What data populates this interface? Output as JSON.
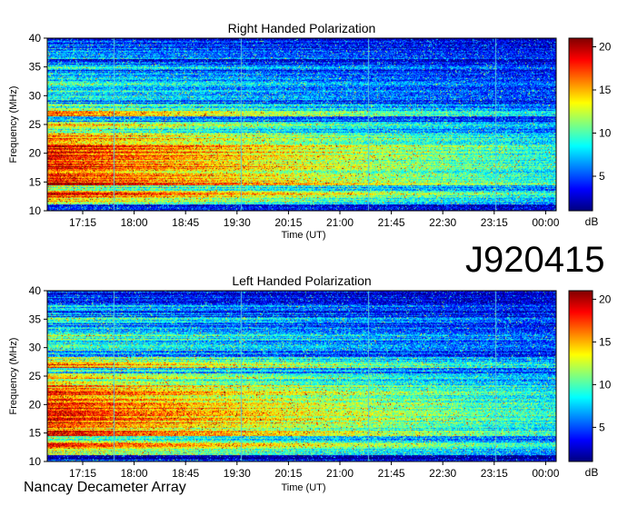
{
  "chart_data": [
    {
      "type": "heatmap",
      "title": "Right Handed Polarization",
      "xlabel": "Time (UT)",
      "ylabel": "Frequency (MHz)",
      "x_ticks": [
        "17:15",
        "18:00",
        "18:45",
        "19:30",
        "20:15",
        "21:00",
        "21:45",
        "22:30",
        "23:15",
        "00:00"
      ],
      "y_ticks": [
        "10",
        "15",
        "20",
        "25",
        "30",
        "35",
        "40"
      ],
      "ylim": [
        10,
        40
      ],
      "colorbar": {
        "ticks": [
          "5",
          "10",
          "15",
          "20"
        ],
        "label": "dB",
        "range": [
          1,
          21
        ]
      },
      "colormap": "jet",
      "colormap_colors": [
        "#00007f",
        "#0000ff",
        "#007fff",
        "#00ffff",
        "#7fff7f",
        "#ffff00",
        "#ff7f00",
        "#ff0000",
        "#7f0000"
      ],
      "intensity_profile_db": [
        {
          "frequency": 10.5,
          "level": 4
        },
        {
          "frequency": 12,
          "level": 14
        },
        {
          "frequency": 13,
          "level": 18
        },
        {
          "frequency": 14,
          "level": 12
        },
        {
          "frequency": 15,
          "level": 19
        },
        {
          "frequency": 16,
          "level": 17
        },
        {
          "frequency": 17,
          "level": 18
        },
        {
          "frequency": 18,
          "level": 19
        },
        {
          "frequency": 19,
          "level": 18
        },
        {
          "frequency": 20,
          "level": 19
        },
        {
          "frequency": 21,
          "level": 18
        },
        {
          "frequency": 22,
          "level": 17
        },
        {
          "frequency": 23,
          "level": 16
        },
        {
          "frequency": 24,
          "level": 12
        },
        {
          "frequency": 25,
          "level": 14
        },
        {
          "frequency": 26,
          "level": 8
        },
        {
          "frequency": 27,
          "level": 16
        },
        {
          "frequency": 28,
          "level": 11
        },
        {
          "frequency": 29,
          "level": 7
        },
        {
          "frequency": 30,
          "level": 9
        },
        {
          "frequency": 31,
          "level": 8
        },
        {
          "frequency": 32,
          "level": 10
        },
        {
          "frequency": 33,
          "level": 7
        },
        {
          "frequency": 34,
          "level": 6
        },
        {
          "frequency": 35,
          "level": 9
        },
        {
          "frequency": 36,
          "level": 5
        },
        {
          "frequency": 37,
          "level": 8
        },
        {
          "frequency": 38,
          "level": 5
        },
        {
          "frequency": 39,
          "level": 6
        },
        {
          "frequency": 40,
          "level": 4
        }
      ]
    },
    {
      "type": "heatmap",
      "title": "Left Handed Polarization",
      "xlabel": "Time (UT)",
      "ylabel": "Frequency (MHz)",
      "x_ticks": [
        "17:15",
        "18:00",
        "18:45",
        "19:30",
        "20:15",
        "21:00",
        "21:45",
        "22:30",
        "23:15",
        "00:00"
      ],
      "y_ticks": [
        "10",
        "15",
        "20",
        "25",
        "30",
        "35",
        "40"
      ],
      "ylim": [
        10,
        40
      ],
      "colorbar": {
        "ticks": [
          "5",
          "10",
          "15",
          "20"
        ],
        "label": "dB",
        "range": [
          1,
          21
        ]
      },
      "colormap": "jet",
      "colormap_colors": [
        "#00007f",
        "#0000ff",
        "#007fff",
        "#00ffff",
        "#7fff7f",
        "#ffff00",
        "#ff7f00",
        "#ff0000",
        "#7f0000"
      ],
      "intensity_profile_db": [
        {
          "frequency": 10.5,
          "level": 4
        },
        {
          "frequency": 12,
          "level": 13
        },
        {
          "frequency": 13,
          "level": 17
        },
        {
          "frequency": 14,
          "level": 12
        },
        {
          "frequency": 15,
          "level": 18
        },
        {
          "frequency": 16,
          "level": 16
        },
        {
          "frequency": 17,
          "level": 18
        },
        {
          "frequency": 18,
          "level": 19
        },
        {
          "frequency": 19,
          "level": 18
        },
        {
          "frequency": 20,
          "level": 19
        },
        {
          "frequency": 21,
          "level": 18
        },
        {
          "frequency": 22,
          "level": 17
        },
        {
          "frequency": 23,
          "level": 16
        },
        {
          "frequency": 24,
          "level": 12
        },
        {
          "frequency": 25,
          "level": 15
        },
        {
          "frequency": 26,
          "level": 9
        },
        {
          "frequency": 27,
          "level": 17
        },
        {
          "frequency": 28,
          "level": 12
        },
        {
          "frequency": 29,
          "level": 8
        },
        {
          "frequency": 30,
          "level": 10
        },
        {
          "frequency": 31,
          "level": 8
        },
        {
          "frequency": 32,
          "level": 11
        },
        {
          "frequency": 33,
          "level": 8
        },
        {
          "frequency": 34,
          "level": 7
        },
        {
          "frequency": 35,
          "level": 10
        },
        {
          "frequency": 36,
          "level": 6
        },
        {
          "frequency": 37,
          "level": 8
        },
        {
          "frequency": 38,
          "level": 5
        },
        {
          "frequency": 39,
          "level": 6
        },
        {
          "frequency": 40,
          "level": 4
        }
      ]
    }
  ],
  "observation_id": "J920415",
  "observatory": "Nancay Decameter Array"
}
